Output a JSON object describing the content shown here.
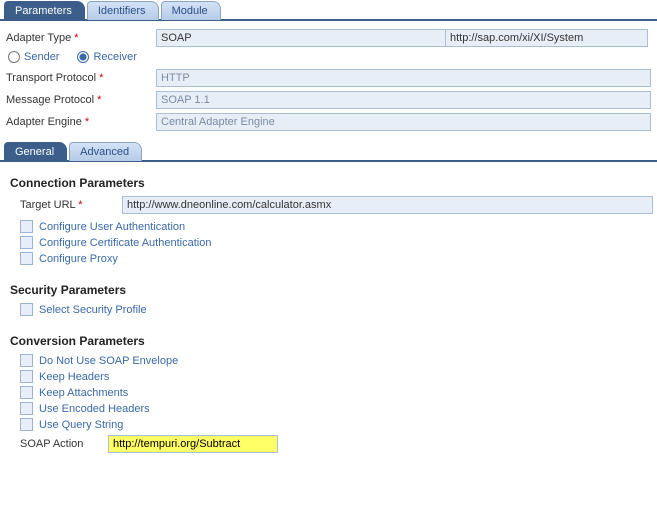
{
  "topTabs": {
    "parameters": "Parameters",
    "identifiers": "Identifiers",
    "module": "Module"
  },
  "adapter": {
    "typeLabel": "Adapter Type",
    "typeValue": "SOAP",
    "typeUrl": "http://sap.com/xi/XI/System",
    "senderLabel": "Sender",
    "receiverLabel": "Receiver",
    "transportLabel": "Transport Protocol",
    "transportValue": "HTTP",
    "messageLabel": "Message Protocol",
    "messageValue": "SOAP 1.1",
    "engineLabel": "Adapter Engine",
    "engineValue": "Central Adapter Engine"
  },
  "subTabs": {
    "general": "General",
    "advanced": "Advanced"
  },
  "connection": {
    "sectionTitle": "Connection Parameters",
    "targetLabel": "Target URL",
    "targetValue": "http://www.dneonline.com/calculator.asmx",
    "cbUserAuth": "Configure User Authentication",
    "cbCertAuth": "Configure Certificate Authentication",
    "cbProxy": "Configure Proxy"
  },
  "security": {
    "sectionTitle": "Security Parameters",
    "cbProfile": "Select Security Profile"
  },
  "conversion": {
    "sectionTitle": "Conversion Parameters",
    "cbNoEnvelope": "Do Not Use SOAP Envelope",
    "cbKeepHeaders": "Keep Headers",
    "cbKeepAttach": "Keep Attachments",
    "cbEncoded": "Use Encoded Headers",
    "cbQuery": "Use Query String",
    "soapActionLabel": "SOAP Action",
    "soapActionValue": "http://tempuri.org/Subtract"
  }
}
